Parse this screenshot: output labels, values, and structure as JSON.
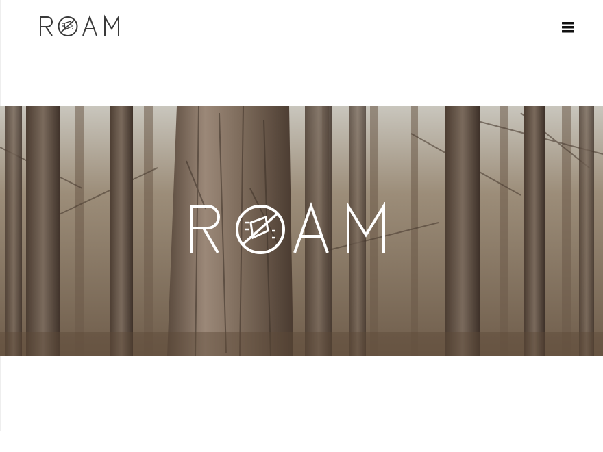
{
  "header": {
    "logo_text": "ROAM",
    "menu_icon": "hamburger-menu-icon",
    "logo_color": "#3a3a3a"
  },
  "hero": {
    "logo_text": "ROAM",
    "logo_color": "#ffffff",
    "background": "forest-tree-trunks-photo"
  }
}
